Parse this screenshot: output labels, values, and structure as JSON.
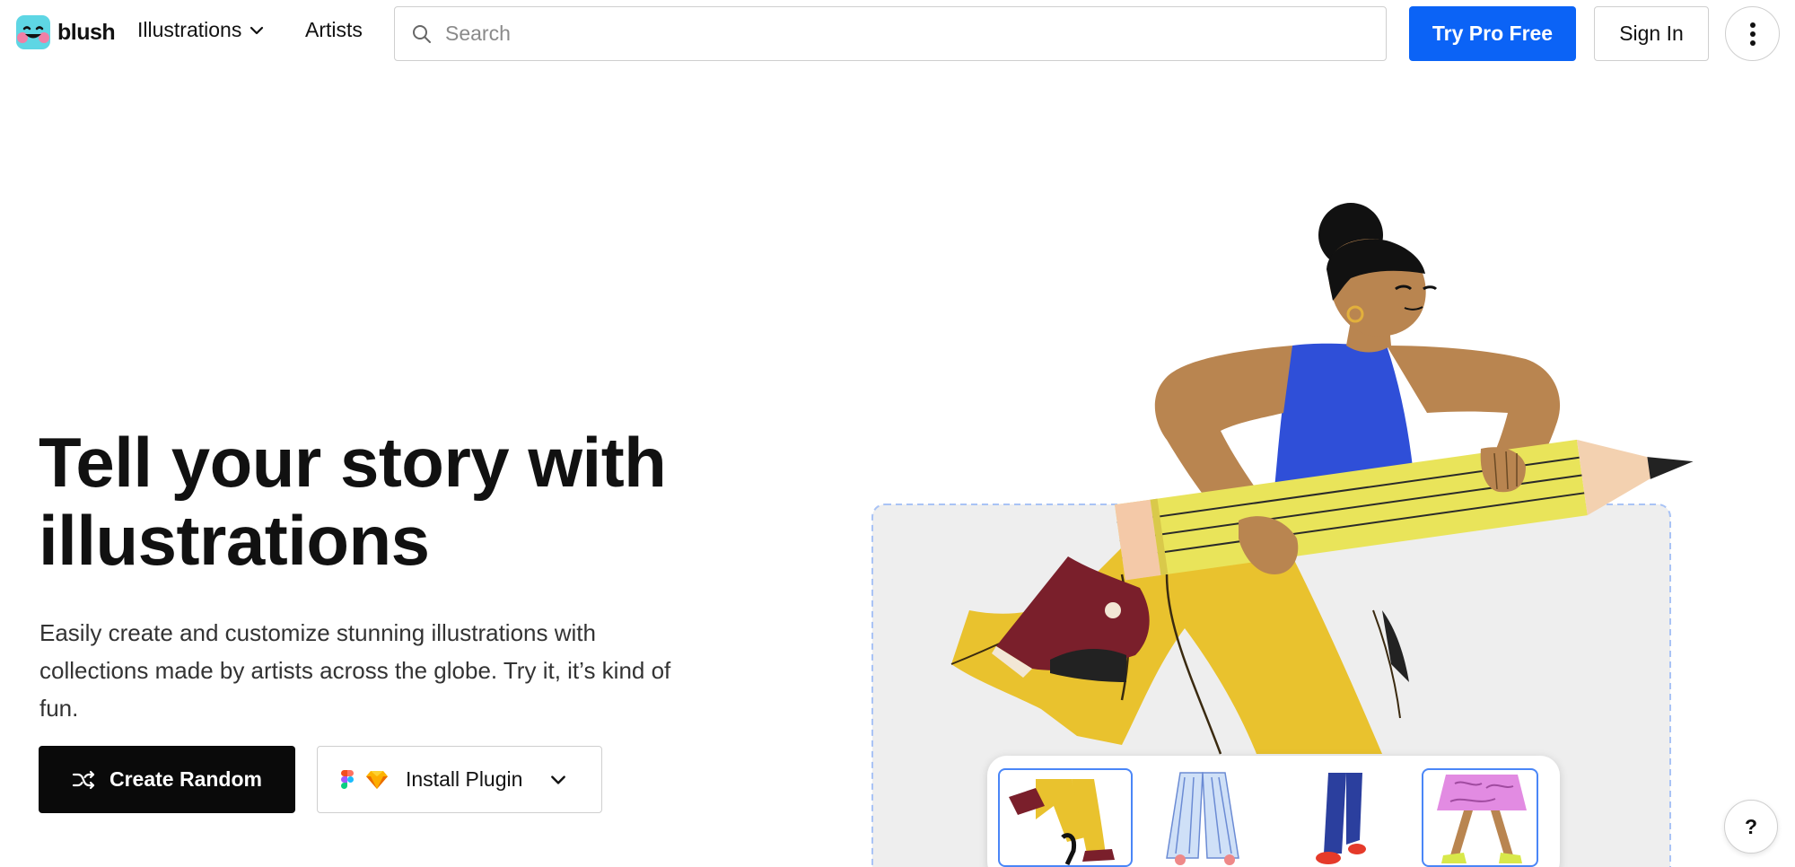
{
  "nav": {
    "logo_text": "blush",
    "illustrations_label": "Illustrations",
    "artists_label": "Artists",
    "search_placeholder": "Search",
    "try_pro_label": "Try Pro Free",
    "sign_in_label": "Sign In"
  },
  "hero": {
    "title_line1": "Tell your story with",
    "title_line2": "illustrations",
    "subtitle_line1": "Easily create and customize stunning illustrations with",
    "subtitle_line2": "collections made by artists across the globe. Try it, it’s kind of",
    "subtitle_line3": "fun.",
    "create_random_label": "Create Random",
    "install_plugin_label": "Install Plugin"
  },
  "help": {
    "label": "?"
  },
  "colors": {
    "brand_blue": "#0b63f6",
    "dark_button": "#0a0a0a",
    "skin": "#b98550",
    "top": "#2f4fd8",
    "pants": "#e9c22e",
    "pencil": "#e9e45a",
    "shoe": "#7a1f2b",
    "canvas_bg": "#eeeeee",
    "canvas_border": "#a9c3f5"
  },
  "icons": {
    "chevron": "chevron-down-icon",
    "search": "search-icon",
    "more": "more-vertical-icon",
    "shuffle": "shuffle-icon",
    "figma": "figma-icon",
    "sketch": "sketch-icon"
  }
}
